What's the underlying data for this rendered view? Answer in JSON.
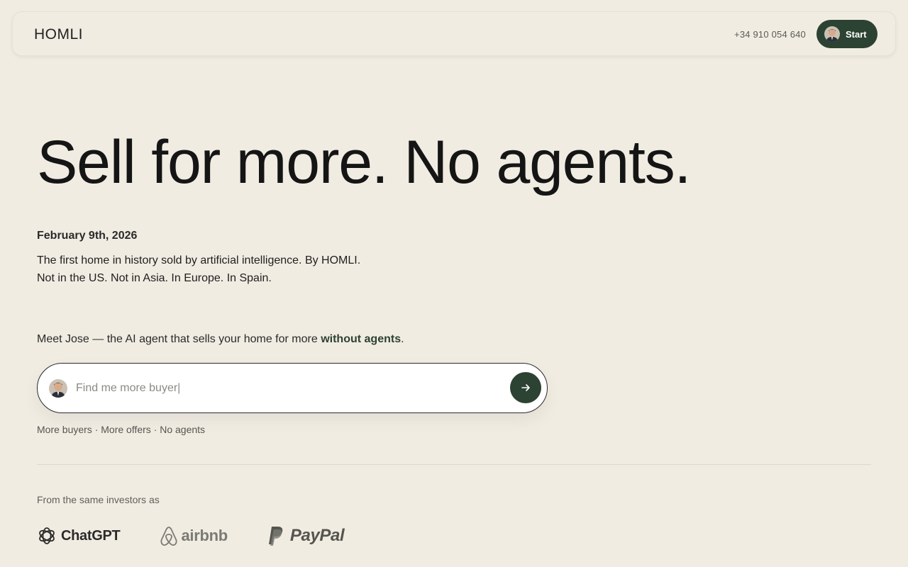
{
  "header": {
    "logo": "HOMLI",
    "phone": "+34 910 054 640",
    "start_label": "Start"
  },
  "hero": {
    "headline": "Sell for more. No agents.",
    "date": "February 9th, 2026",
    "story_line1": "The first home in history sold by artificial intelligence. By HOMLI.",
    "story_line2": "Not in the US. Not in Asia. In Europe. In Spain."
  },
  "agent": {
    "intro_prefix": "Meet Jose — the AI agent that sells your home for more ",
    "intro_highlight": "without agents",
    "intro_suffix": ".",
    "input_value": "",
    "input_placeholder": "Find me more buyer|",
    "send_icon": "arrow-right-icon",
    "benefits": "More buyers · More offers · No agents"
  },
  "investors": {
    "label": "From the same investors as",
    "logos": [
      {
        "name": "ChatGPT",
        "icon": "openai-icon"
      },
      {
        "name": "airbnb",
        "icon": "airbnb-icon"
      },
      {
        "name": "PayPal",
        "icon": "paypal-icon"
      }
    ]
  },
  "colors": {
    "background": "#f1ece2",
    "accent": "#2c4232",
    "text": "#151515"
  }
}
